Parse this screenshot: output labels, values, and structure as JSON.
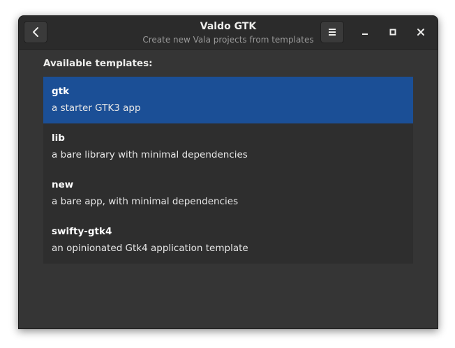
{
  "window": {
    "title": "Valdo GTK",
    "subtitle": "Create new Vala projects from templates"
  },
  "header": {
    "back_icon": "go-back-icon",
    "menu_icon": "hamburger-menu-icon",
    "minimize_icon": "minimize-icon",
    "maximize_icon": "maximize-icon",
    "close_icon": "close-icon"
  },
  "main": {
    "section_label": "Available templates:",
    "selected_index": 0,
    "templates": [
      {
        "name": "gtk",
        "description": "a starter GTK3 app"
      },
      {
        "name": "lib",
        "description": "a bare library with minimal dependencies"
      },
      {
        "name": "new",
        "description": "a bare app, with minimal dependencies"
      },
      {
        "name": "swifty-gtk4",
        "description": "an opinionated Gtk4 application template"
      }
    ]
  },
  "colors": {
    "window_bg": "#353535",
    "headerbar_bg": "#2b2b2b",
    "list_bg": "#2e2e2e",
    "selection": "#1b4f96"
  }
}
